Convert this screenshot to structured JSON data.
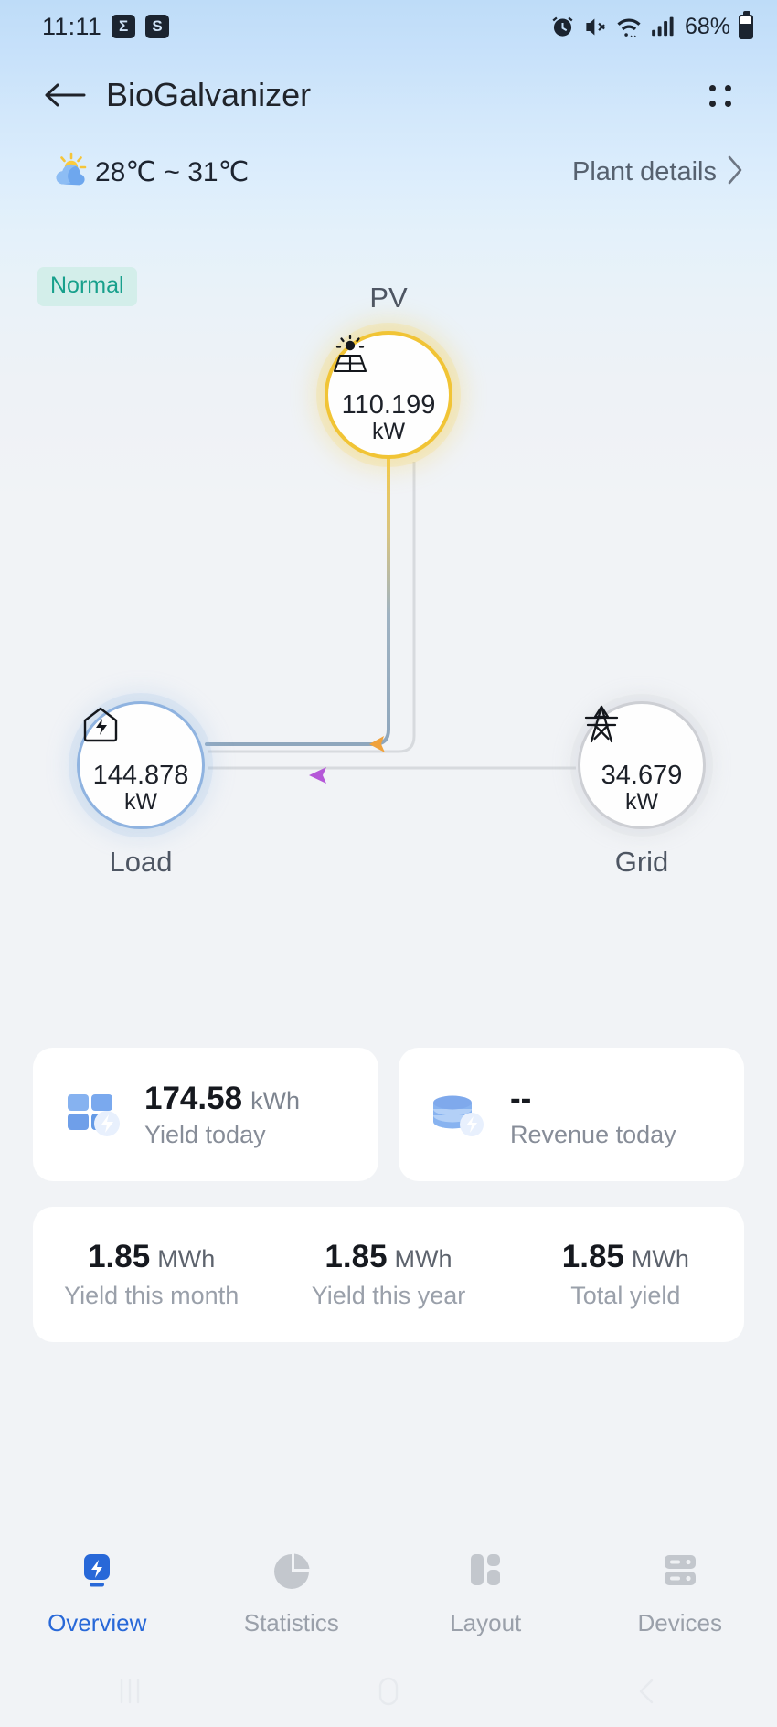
{
  "status_bar": {
    "time": "11:11",
    "icons_left": [
      "sigma-app-icon",
      "shopee-app-icon"
    ],
    "sigma_glyph": "Σ",
    "shopee_glyph": "S",
    "icons_right": [
      "alarm-icon",
      "mute-icon",
      "wifi-icon",
      "signal-icon"
    ],
    "battery_percent": "68%"
  },
  "app_bar": {
    "back_icon": "back-arrow-icon",
    "title": "BioGalvanizer",
    "menu_icon": "grid-menu-icon"
  },
  "weather": {
    "icon": "partly-cloudy-icon",
    "range": "28℃ ~ 31℃",
    "plant_details_label": "Plant details",
    "chevron_icon": "chevron-right-icon"
  },
  "status_badge": {
    "label": "Normal",
    "text_color": "#18a08c",
    "bg_color": "#d3eeea"
  },
  "flow_diagram": {
    "nodes": [
      {
        "id": "pv",
        "label": "PV",
        "value": "110.199",
        "unit": "kW",
        "icon": "solar-panel-icon",
        "ring_color": "#f1c435"
      },
      {
        "id": "load",
        "label": "Load",
        "value": "144.878",
        "unit": "kW",
        "icon": "house-bolt-icon",
        "ring_color": "#8fb3e0"
      },
      {
        "id": "grid",
        "label": "Grid",
        "value": "34.679",
        "unit": "kW",
        "icon": "pylon-icon",
        "ring_color": "#cdcfd4"
      }
    ],
    "flows": [
      {
        "id": "pv-to-load",
        "from": "pv",
        "to": "load",
        "arrow_color": "#f0a23c"
      },
      {
        "id": "grid-to-load",
        "from": "grid",
        "to": "load",
        "arrow_color": "#b558d8"
      }
    ]
  },
  "cards": [
    {
      "icon": "solar-panel-blue-icon",
      "value": "174.58",
      "unit": "kWh",
      "label": "Yield today"
    },
    {
      "icon": "coins-stack-icon",
      "value": "--",
      "unit": "",
      "label": "Revenue today"
    }
  ],
  "yield_summary": [
    {
      "value": "1.85",
      "unit": "MWh",
      "label": "Yield this month"
    },
    {
      "value": "1.85",
      "unit": "MWh",
      "label": "Yield this year"
    },
    {
      "value": "1.85",
      "unit": "MWh",
      "label": "Total yield"
    }
  ],
  "tabs": [
    {
      "id": "overview",
      "label": "Overview",
      "icon": "overview-bolt-icon",
      "active": true
    },
    {
      "id": "statistics",
      "label": "Statistics",
      "icon": "pie-chart-icon",
      "active": false
    },
    {
      "id": "layout",
      "label": "Layout",
      "icon": "layout-blocks-icon",
      "active": false
    },
    {
      "id": "devices",
      "label": "Devices",
      "icon": "server-rack-icon",
      "active": false
    }
  ],
  "android_nav": {
    "recents_icon": "recents-icon",
    "home_icon": "home-icon",
    "back_icon": "back-chevron-icon"
  },
  "colors": {
    "accent": "#2868d8",
    "pv": "#f1c435",
    "load": "#8fb3e0",
    "grid": "#cdcfd4",
    "pv_flow_arrow": "#f0a23c",
    "grid_flow_arrow": "#b558d8"
  }
}
